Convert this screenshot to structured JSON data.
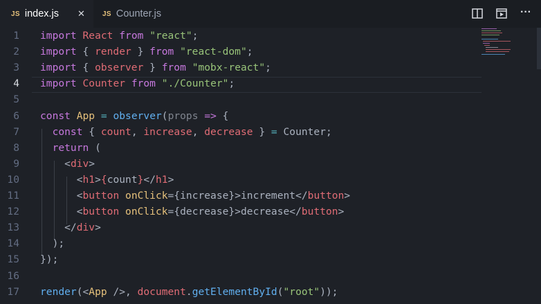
{
  "tabs": [
    {
      "icon_label": "JS",
      "name": "index.js",
      "active": true,
      "close": "✕"
    },
    {
      "icon_label": "JS",
      "name": "Counter.js",
      "active": false
    }
  ],
  "toolbar_icons": [
    "split-editor-icon",
    "preview-icon",
    "more-actions-icon"
  ],
  "more_glyph": "···",
  "editor": {
    "current_line": 4,
    "lines": [
      {
        "n": "1",
        "tokens": [
          [
            "k",
            "import"
          ],
          [
            "p",
            " "
          ],
          [
            "v",
            "React"
          ],
          [
            "p",
            " "
          ],
          [
            "k",
            "from"
          ],
          [
            "p",
            " "
          ],
          [
            "s",
            "\"react\""
          ],
          [
            "p",
            ";"
          ]
        ]
      },
      {
        "n": "2",
        "tokens": [
          [
            "k",
            "import"
          ],
          [
            "p",
            " { "
          ],
          [
            "v",
            "render"
          ],
          [
            "p",
            " } "
          ],
          [
            "k",
            "from"
          ],
          [
            "p",
            " "
          ],
          [
            "s",
            "\"react-dom\""
          ],
          [
            "p",
            ";"
          ]
        ]
      },
      {
        "n": "3",
        "tokens": [
          [
            "k",
            "import"
          ],
          [
            "p",
            " { "
          ],
          [
            "v",
            "observer"
          ],
          [
            "p",
            " } "
          ],
          [
            "k",
            "from"
          ],
          [
            "p",
            " "
          ],
          [
            "s",
            "\"mobx-react\""
          ],
          [
            "p",
            ";"
          ]
        ]
      },
      {
        "n": "4",
        "tokens": [
          [
            "k",
            "import"
          ],
          [
            "p",
            " "
          ],
          [
            "v",
            "Counter"
          ],
          [
            "p",
            " "
          ],
          [
            "k",
            "from"
          ],
          [
            "p",
            " "
          ],
          [
            "s",
            "\"./Counter\""
          ],
          [
            "p",
            ";"
          ]
        ]
      },
      {
        "n": "5",
        "tokens": []
      },
      {
        "n": "6",
        "tokens": [
          [
            "k",
            "const"
          ],
          [
            "p",
            " "
          ],
          [
            "y",
            "App"
          ],
          [
            "p",
            " "
          ],
          [
            "o",
            "="
          ],
          [
            "p",
            " "
          ],
          [
            "f",
            "observer"
          ],
          [
            "p",
            "("
          ],
          [
            "g",
            "props"
          ],
          [
            "p",
            " "
          ],
          [
            "k",
            "=>"
          ],
          [
            "p",
            " {"
          ]
        ]
      },
      {
        "n": "7",
        "tokens": [
          [
            "p",
            "  "
          ],
          [
            "k",
            "const"
          ],
          [
            "p",
            " { "
          ],
          [
            "v",
            "count"
          ],
          [
            "p",
            ", "
          ],
          [
            "v",
            "increase"
          ],
          [
            "p",
            ", "
          ],
          [
            "v",
            "decrease"
          ],
          [
            "p",
            " } "
          ],
          [
            "o",
            "="
          ],
          [
            "p",
            " Counter;"
          ]
        ]
      },
      {
        "n": "8",
        "tokens": [
          [
            "p",
            "  "
          ],
          [
            "k",
            "return"
          ],
          [
            "p",
            " ("
          ]
        ]
      },
      {
        "n": "9",
        "tokens": [
          [
            "p",
            "    <"
          ],
          [
            "v",
            "div"
          ],
          [
            "p",
            ">"
          ]
        ]
      },
      {
        "n": "10",
        "tokens": [
          [
            "p",
            "      <"
          ],
          [
            "v",
            "h1"
          ],
          [
            "p",
            ">"
          ],
          [
            "v",
            "{"
          ],
          [
            "p",
            "count"
          ],
          [
            "v",
            "}"
          ],
          [
            "p",
            "</"
          ],
          [
            "v",
            "h1"
          ],
          [
            "p",
            ">"
          ]
        ]
      },
      {
        "n": "11",
        "tokens": [
          [
            "p",
            "      <"
          ],
          [
            "v",
            "button"
          ],
          [
            "p",
            " "
          ],
          [
            "y",
            "onClick"
          ],
          [
            "p",
            "="
          ],
          [
            "p",
            "{increase}"
          ],
          [
            "p",
            ">increment</"
          ],
          [
            "v",
            "button"
          ],
          [
            "p",
            ">"
          ]
        ]
      },
      {
        "n": "12",
        "tokens": [
          [
            "p",
            "      <"
          ],
          [
            "v",
            "button"
          ],
          [
            "p",
            " "
          ],
          [
            "y",
            "onClick"
          ],
          [
            "p",
            "="
          ],
          [
            "p",
            "{decrease}"
          ],
          [
            "p",
            ">decrease</"
          ],
          [
            "v",
            "button"
          ],
          [
            "p",
            ">"
          ]
        ]
      },
      {
        "n": "13",
        "tokens": [
          [
            "p",
            "    </"
          ],
          [
            "v",
            "div"
          ],
          [
            "p",
            ">"
          ]
        ]
      },
      {
        "n": "14",
        "tokens": [
          [
            "p",
            "  );"
          ]
        ]
      },
      {
        "n": "15",
        "tokens": [
          [
            "p",
            "});"
          ]
        ]
      },
      {
        "n": "16",
        "tokens": []
      },
      {
        "n": "17",
        "tokens": [
          [
            "f",
            "render"
          ],
          [
            "p",
            "(<"
          ],
          [
            "y",
            "App"
          ],
          [
            "p",
            " />, "
          ],
          [
            "v",
            "document"
          ],
          [
            "p",
            "."
          ],
          [
            "f",
            "getElementById"
          ],
          [
            "p",
            "("
          ],
          [
            "s",
            "\"root\""
          ],
          [
            "p",
            "));"
          ]
        ]
      }
    ]
  },
  "colors": {
    "background": "#1e2127",
    "tabbar": "#1a1d22",
    "keyword": "#c678dd",
    "string": "#98c379",
    "variable": "#e06c75",
    "function": "#61afef",
    "operator": "#56b6c2",
    "type": "#e5c07b",
    "text": "#abb2bf",
    "line_number": "#636d83"
  }
}
